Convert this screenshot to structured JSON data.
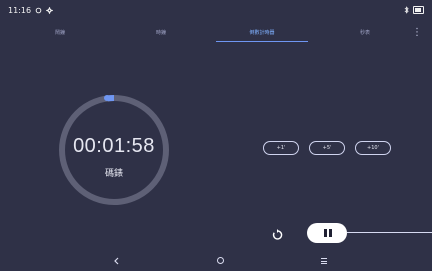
{
  "status_bar": {
    "time": "11:16",
    "left_icons": [
      "sync-icon",
      "gear-icon"
    ],
    "right_icons": [
      "bluetooth-icon",
      "battery-icon"
    ]
  },
  "tabs": [
    {
      "label": "鬧鐘",
      "active": false
    },
    {
      "label": "時鐘",
      "active": false
    },
    {
      "label": "倒數計時器",
      "active": true
    },
    {
      "label": "秒表",
      "active": false
    }
  ],
  "timer": {
    "display": "00:01:58",
    "label": "碼錶",
    "progress_fraction": 0.02
  },
  "quick_add": [
    "+1'",
    "+5'",
    "+10'"
  ],
  "controls": {
    "reset_icon": "reset-icon",
    "pause_icon": "pause-icon"
  },
  "nav": {
    "icons": [
      "back-icon",
      "home-icon",
      "menu-icon"
    ]
  },
  "colors": {
    "background": "#2f3147",
    "accent": "#6f96f2",
    "ring": "#5e6076"
  }
}
